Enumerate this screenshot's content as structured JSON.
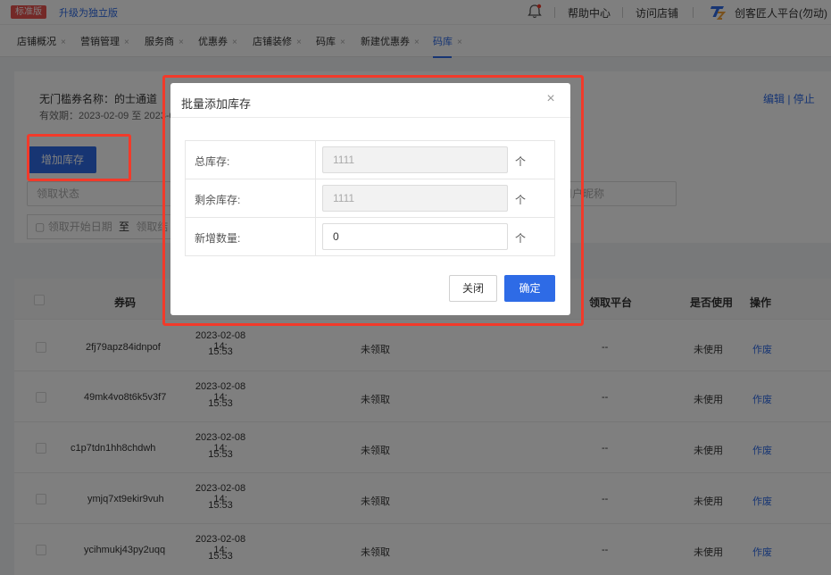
{
  "topbar": {
    "edition_badge": "标准版",
    "upgrade_link": "升级为独立版",
    "help_center": "帮助中心",
    "visit_store": "访问店铺",
    "account": "创客匠人平台(勿动)"
  },
  "tabs": [
    {
      "label": "店铺概况"
    },
    {
      "label": "营销管理"
    },
    {
      "label": "服务商"
    },
    {
      "label": "优惠券"
    },
    {
      "label": "店铺装修"
    },
    {
      "label": "码库"
    },
    {
      "label": "新建优惠券"
    },
    {
      "label": "码库",
      "active": true
    }
  ],
  "coupon": {
    "name": "无门槛券名称：的士通道",
    "period": "有效期：2023-02-09 至 2023-0",
    "actions": "编辑 | 停止"
  },
  "add_stock_button": "增加库存",
  "filters": {
    "claim_status_placeholder": "领取状态",
    "user_name_placeholder": "用户昵称",
    "date_start_placeholder": "领取开始日期",
    "date_to": "至",
    "date_end_placeholder": "领取结"
  },
  "table": {
    "columns": {
      "code": "券码",
      "platform": "领取平台",
      "used": "是否使用",
      "actions": "操作"
    },
    "rows": [
      {
        "code": "2fj79apz84idnpof",
        "date_line1": "2023-02-08 14:",
        "date_line2": "15:53",
        "status": "未领取",
        "platform": "--",
        "used": "未使用",
        "action": "作废"
      },
      {
        "code": "49mk4vo8t6k5v3f7",
        "date_line1": "2023-02-08 14:",
        "date_line2": "15:53",
        "status": "未领取",
        "platform": "--",
        "used": "未使用",
        "action": "作废"
      },
      {
        "code": "c1p7tdn1hh8chdwh",
        "date_line1": "2023-02-08 14:",
        "date_line2": "15:53",
        "status": "未领取",
        "platform": "--",
        "used": "未使用",
        "action": "作废"
      },
      {
        "code": "ymjq7xt9ekir9vuh",
        "date_line1": "2023-02-08 14:",
        "date_line2": "15:53",
        "status": "未领取",
        "platform": "--",
        "used": "未使用",
        "action": "作废"
      },
      {
        "code": "ycihmukj43py2uqq",
        "date_line1": "2023-02-08 14:",
        "date_line2": "15:53",
        "status": "未领取",
        "platform": "--",
        "used": "未使用",
        "action": "作废"
      }
    ]
  },
  "modal": {
    "title": "批量添加库存",
    "total_stock_label": "总库存:",
    "total_stock_value": "1111",
    "remaining_stock_label": "剩余库存:",
    "remaining_stock_value": "1111",
    "add_quantity_label": "新增数量:",
    "add_quantity_value": "0",
    "unit": "个",
    "cancel_button": "关闭",
    "confirm_button": "确定"
  },
  "colors": {
    "primary": "#2e6be6",
    "highlight": "#f23a2a",
    "badge": "#e8524f"
  },
  "icons": [
    "bell-icon",
    "close-icon",
    "calendar-icon",
    "brand-logo-icon"
  ]
}
